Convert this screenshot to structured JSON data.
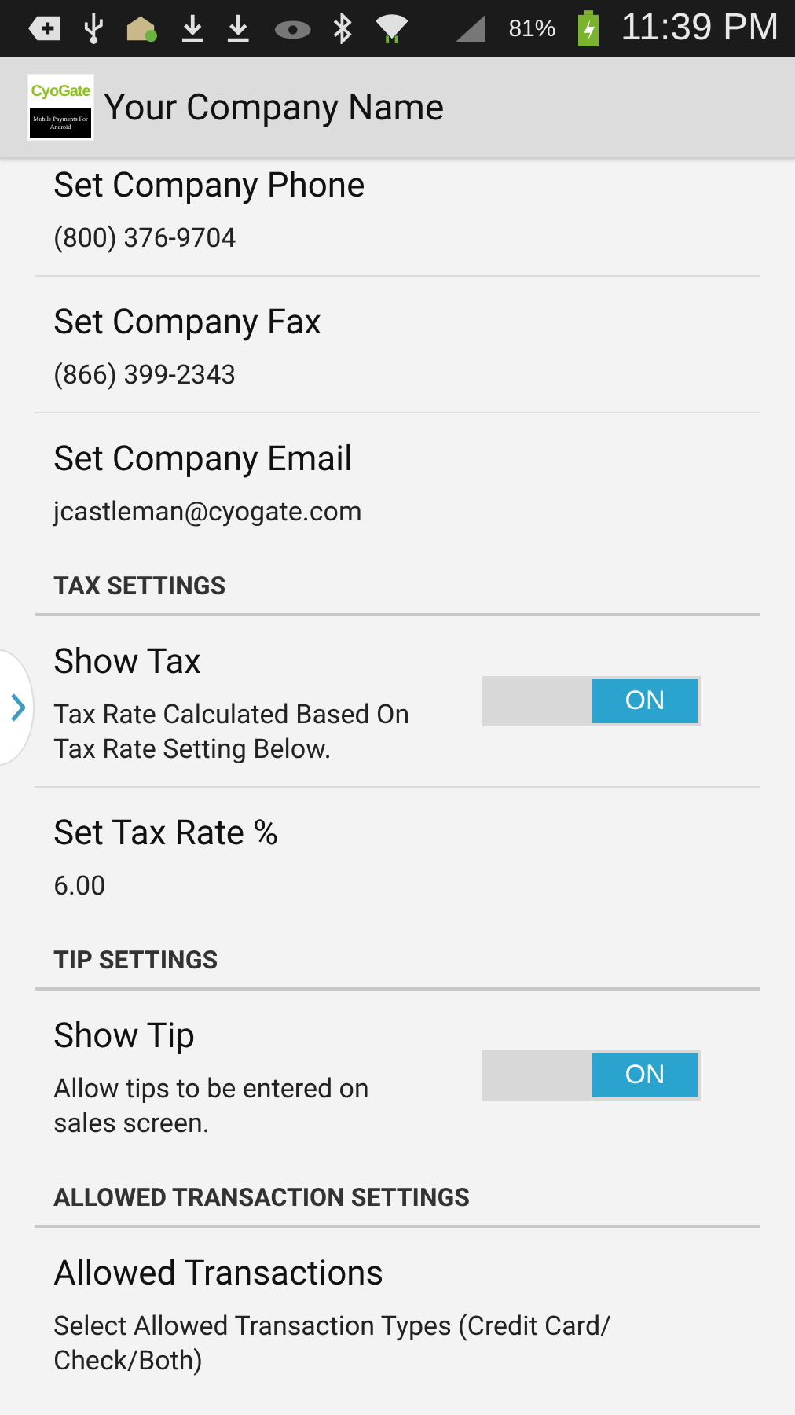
{
  "status_bar": {
    "battery": "81%",
    "time": "11:39 PM"
  },
  "action_bar": {
    "title": "Your Company Name",
    "logo": {
      "name": "CyoGate",
      "tagline": "Mobile Payments For Android"
    }
  },
  "settings": [
    {
      "kind": "item",
      "title": "Set Company Phone",
      "summary": "(800) 376-9704"
    },
    {
      "kind": "item",
      "title": "Set Company Fax",
      "summary": "(866) 399-2343"
    },
    {
      "kind": "item",
      "title": "Set Company Email",
      "summary": "jcastleman@cyogate.com"
    },
    {
      "kind": "section",
      "title": "TAX SETTINGS"
    },
    {
      "kind": "toggle",
      "title": "Show Tax",
      "summary": "Tax Rate Calculated Based On Tax Rate Setting Below.",
      "on": true,
      "toggle_label": "ON"
    },
    {
      "kind": "item",
      "title": "Set Tax Rate %",
      "summary": "6.00"
    },
    {
      "kind": "section",
      "title": "TIP SETTINGS"
    },
    {
      "kind": "toggle",
      "title": "Show Tip",
      "summary": "Allow tips to be entered on sales screen.",
      "on": true,
      "toggle_label": "ON"
    },
    {
      "kind": "section",
      "title": "ALLOWED TRANSACTION SETTINGS"
    },
    {
      "kind": "item",
      "title": "Allowed Transactions",
      "summary": "Select Allowed Transaction Types (Credit Card/ Check/Both)"
    }
  ]
}
